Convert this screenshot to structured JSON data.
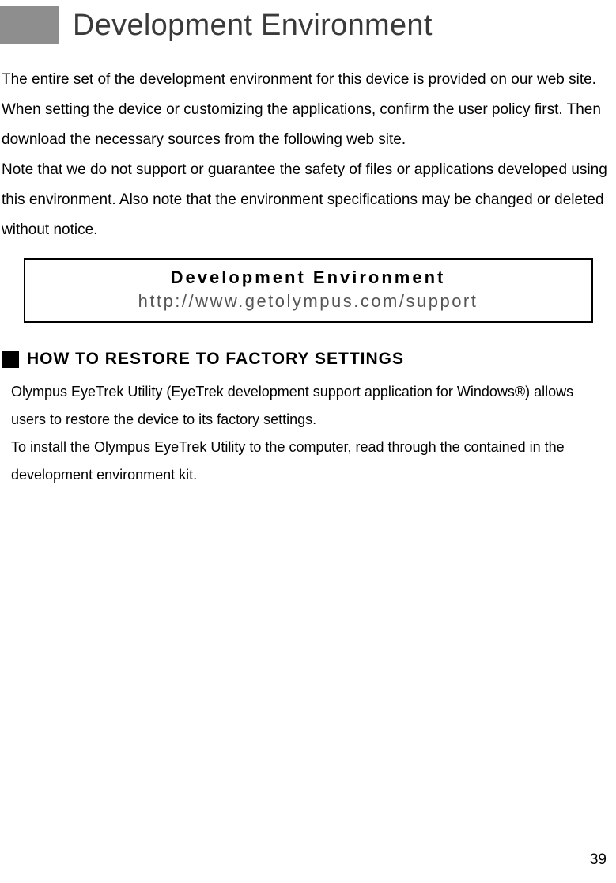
{
  "header": {
    "title": "Development Environment"
  },
  "intro": {
    "text": "The entire set of the development environment for this device is provided on our web site.\nWhen setting the device or customizing the applications, confirm the user policy first. Then download the necessary sources from the following web site.\nNote that we do not support or guarantee the safety of files or applications developed using this environment. Also note that the environment specifications may be changed or deleted without notice."
  },
  "callout": {
    "title": "Development Environment",
    "url": "http://www.getolympus.com/support"
  },
  "section": {
    "heading": "HOW TO RESTORE TO FACTORY SETTINGS",
    "body": "Olympus EyeTrek Utility (EyeTrek development support application for Windows®) allows users to restore the device to its factory settings.\nTo install the Olympus EyeTrek Utility to the computer, read through the contained in the development environment kit."
  },
  "page_number": "39"
}
